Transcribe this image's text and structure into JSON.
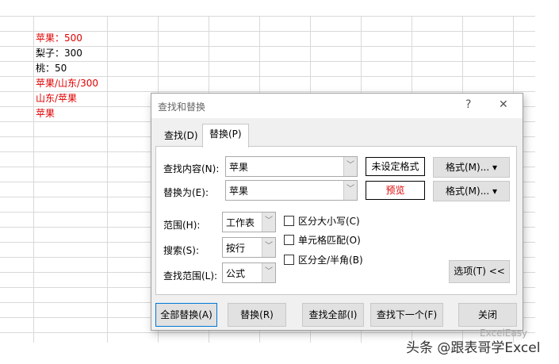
{
  "cells": [
    "苹果：500",
    "梨子：300",
    "桃：50",
    "苹果/山东/300",
    "山东/苹果",
    "苹果"
  ],
  "dialog": {
    "title": "查找和替换",
    "help": "?",
    "close": "✕",
    "tabs": [
      "查找(D)",
      "替换(P)"
    ],
    "find_label": "查找内容(N):",
    "find_value": "苹果",
    "find_format": "未设定格式",
    "format_btn": "格式(M)...",
    "replace_label": "替换为(E):",
    "replace_value": "苹果",
    "replace_preview": "预览",
    "scope_label": "范围(H):",
    "scope_value": "工作表",
    "search_label": "搜索(S):",
    "search_value": "按行",
    "lookin_label": "查找范围(L):",
    "lookin_value": "公式",
    "checkboxes": [
      "区分大小写(C)",
      "单元格匹配(O)",
      "区分全/半角(B)"
    ],
    "options_btn": "选项(T) <<",
    "buttons": [
      "全部替换(A)",
      "替换(R)",
      "查找全部(I)",
      "查找下一个(F)",
      "关闭"
    ]
  },
  "watermark": "头条 @跟表哥学Excel",
  "watermark_logo": "ExcelEasy"
}
